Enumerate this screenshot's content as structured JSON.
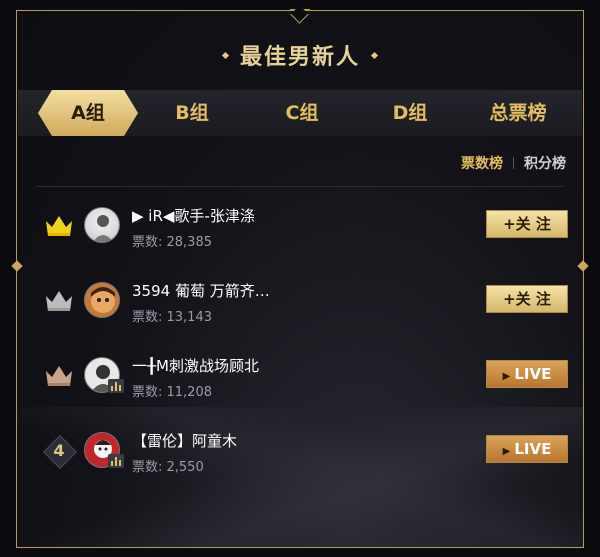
{
  "header": {
    "title": "最佳男新人"
  },
  "tabs": [
    {
      "label": "A组",
      "active": true
    },
    {
      "label": "B组",
      "active": false
    },
    {
      "label": "C组",
      "active": false
    },
    {
      "label": "D组",
      "active": false
    },
    {
      "label": "总票榜",
      "active": false
    }
  ],
  "subtabs": {
    "votes": "票数榜",
    "points": "积分榜"
  },
  "ranking": [
    {
      "rank": "1",
      "rank_icon": "gold-crown-icon",
      "name": "▶ iR◀歌手-张津涤",
      "votes_label": "票数: 28,385",
      "action": "+关 注",
      "action_type": "follow",
      "live_badge": false
    },
    {
      "rank": "2",
      "rank_icon": "silver-crown-icon",
      "name": "3594 葡萄 万箭齐…",
      "votes_label": "票数: 13,143",
      "action": "+关 注",
      "action_type": "follow",
      "live_badge": false
    },
    {
      "rank": "3",
      "rank_icon": "bronze-crown-icon",
      "name": "一╂M刺激战场顾北",
      "votes_label": "票数: 11,208",
      "action": "LIVE",
      "action_type": "live",
      "live_badge": true
    },
    {
      "rank": "4",
      "rank_icon": "number-badge",
      "name": "【雷伦】阿童木",
      "votes_label": "票数: 2,550",
      "action": "LIVE",
      "action_type": "live",
      "live_badge": true
    }
  ],
  "colors": {
    "gold": "#e3bd63",
    "border": "#b39a5e",
    "crown_gold": "#f2d31c",
    "crown_silver": "#bdbdbd",
    "crown_bronze": "#c9a48a"
  }
}
